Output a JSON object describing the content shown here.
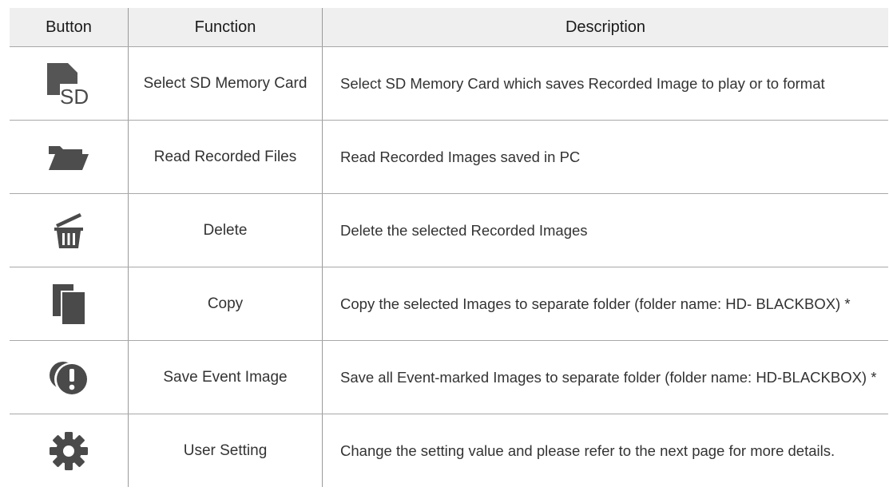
{
  "header": {
    "button": "Button",
    "function": "Function",
    "description": "Description"
  },
  "rows": [
    {
      "icon": "sd-card-icon",
      "function": "Select SD Memory Card",
      "description": "Select SD Memory Card which saves Recorded Image to play or to format"
    },
    {
      "icon": "folder-open-icon",
      "function": "Read Recorded Files",
      "description": "Read Recorded Images saved in PC"
    },
    {
      "icon": "trash-icon",
      "function": "Delete",
      "description": "Delete the selected Recorded Images"
    },
    {
      "icon": "copy-icon",
      "function": "Copy",
      "description": "Copy the selected Images to separate folder (folder name: HD- BLACKBOX) *"
    },
    {
      "icon": "event-alert-icon",
      "function": "Save Event Image",
      "description": "Save all Event-marked Images to separate folder (folder name: HD-BLACKBOX) *"
    },
    {
      "icon": "gear-icon",
      "function": "User Setting",
      "description": "Change the setting value and please refer to the next page for more details."
    }
  ],
  "sd_icon_text": "SD",
  "colors": {
    "icon": "#4a4a4a",
    "header_bg": "#efefef",
    "divider": "#a8a8a8"
  }
}
